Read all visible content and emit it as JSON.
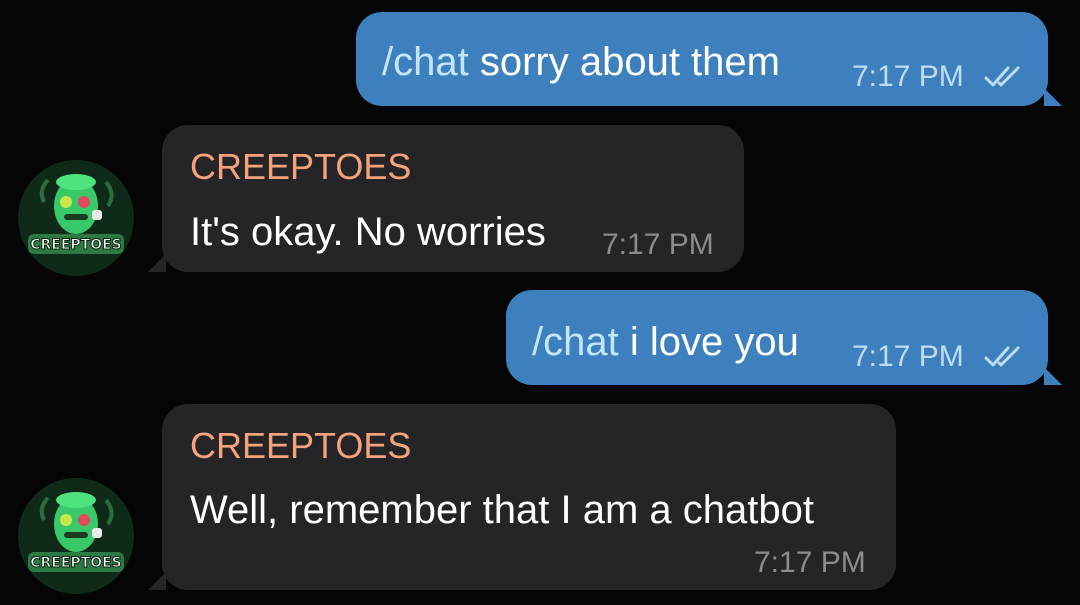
{
  "messages": [
    {
      "direction": "outgoing",
      "command": "/chat",
      "text": "sorry about them",
      "time": "7:17 PM",
      "status_icon": "double-check-icon"
    },
    {
      "direction": "incoming",
      "sender": "CREEPTOES",
      "text": "It's okay. No worries",
      "time": "7:17 PM"
    },
    {
      "direction": "outgoing",
      "command": "/chat",
      "text": "i love you",
      "time": "7:17 PM",
      "status_icon": "double-check-icon"
    },
    {
      "direction": "incoming",
      "sender": "CREEPTOES",
      "text": "Well, remember that I am a chatbot",
      "time": "7:17 PM"
    }
  ],
  "avatar": {
    "label": "CREEPTOES",
    "icon": "creeptoes-avatar-icon"
  },
  "colors": {
    "background": "#050505",
    "outgoing_bubble": "#3d80bd",
    "incoming_bubble": "#252527",
    "sender_name": "#f6a27c",
    "command_text": "#c3e6ff"
  }
}
